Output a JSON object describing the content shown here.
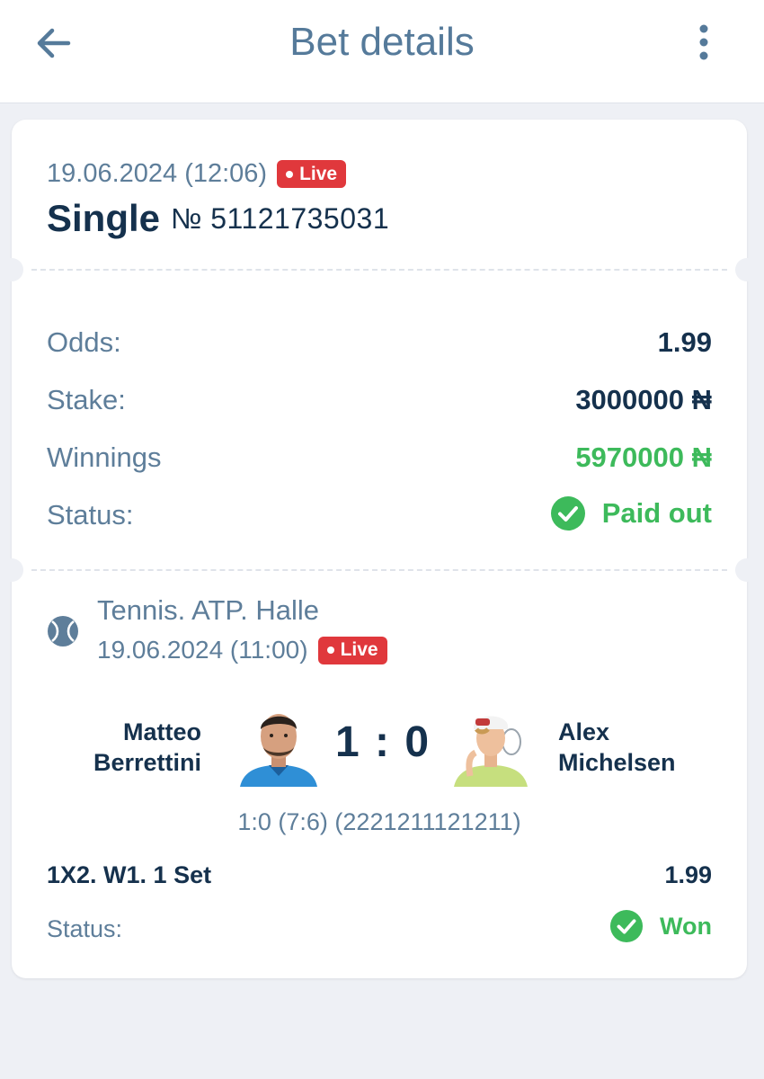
{
  "header": {
    "title": "Bet details",
    "back_icon": "arrow-left-icon",
    "menu_icon": "more-vertical-icon"
  },
  "bet": {
    "date": "19.06.2024 (12:06)",
    "live_label": "Live",
    "type": "Single",
    "number": "№ 51121735031"
  },
  "summary": {
    "odds_label": "Odds:",
    "odds_value": "1.99",
    "stake_label": "Stake:",
    "stake_value": "3000000 ₦",
    "winnings_label": "Winnings",
    "winnings_value": "5970000 ₦",
    "status_label": "Status:",
    "status_value": "Paid out"
  },
  "event": {
    "sport_icon": "tennis-ball-icon",
    "title": "Tennis. ATP. Halle",
    "date": "19.06.2024 (11:00)",
    "live_label": "Live",
    "player1": "Matteo\nBerrettini",
    "player2": "Alex\nMichelsen",
    "score": "1 : 0",
    "score_detail": "1:0 (7:6) (2221211121211)"
  },
  "selection": {
    "market": "1X2. W1. 1 Set",
    "odds": "1.99",
    "status_label": "Status:",
    "status_value": "Won"
  },
  "colors": {
    "accent": "#557a9a",
    "dark_text": "#15314d",
    "muted_text": "#5e7e9a",
    "live_red": "#e0383c",
    "success_green": "#3dba5b",
    "background": "#eef0f5"
  }
}
